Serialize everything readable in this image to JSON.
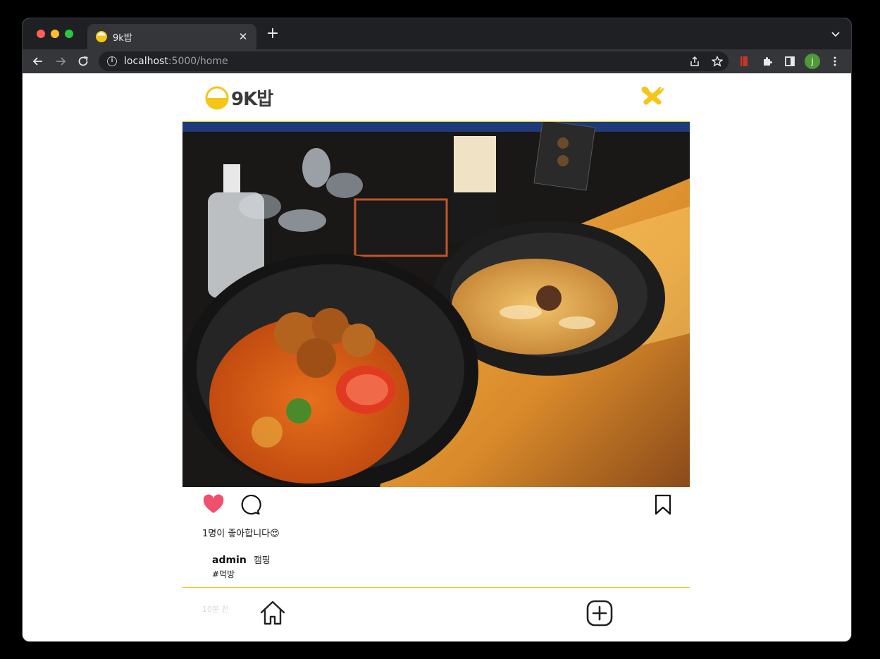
{
  "browser": {
    "tab_title": "9k밥",
    "url_host": "localhost",
    "url_rest": ":5000/home",
    "profile_initial": "j"
  },
  "app": {
    "logo_text": "9K밥",
    "brand_color": "#f5c518"
  },
  "post": {
    "likes_text": "1명이 좋아합니다😍",
    "liked": true,
    "author": "admin",
    "caption": "캠핑",
    "hashtag": "#먹방",
    "comment_time": "10분 전"
  },
  "icons": {
    "menu": "fork-spoon-icon",
    "like": "heart-icon",
    "comment": "comment-bubble-icon",
    "save": "bookmark-icon",
    "home": "home-icon",
    "add": "plus-square-icon"
  }
}
